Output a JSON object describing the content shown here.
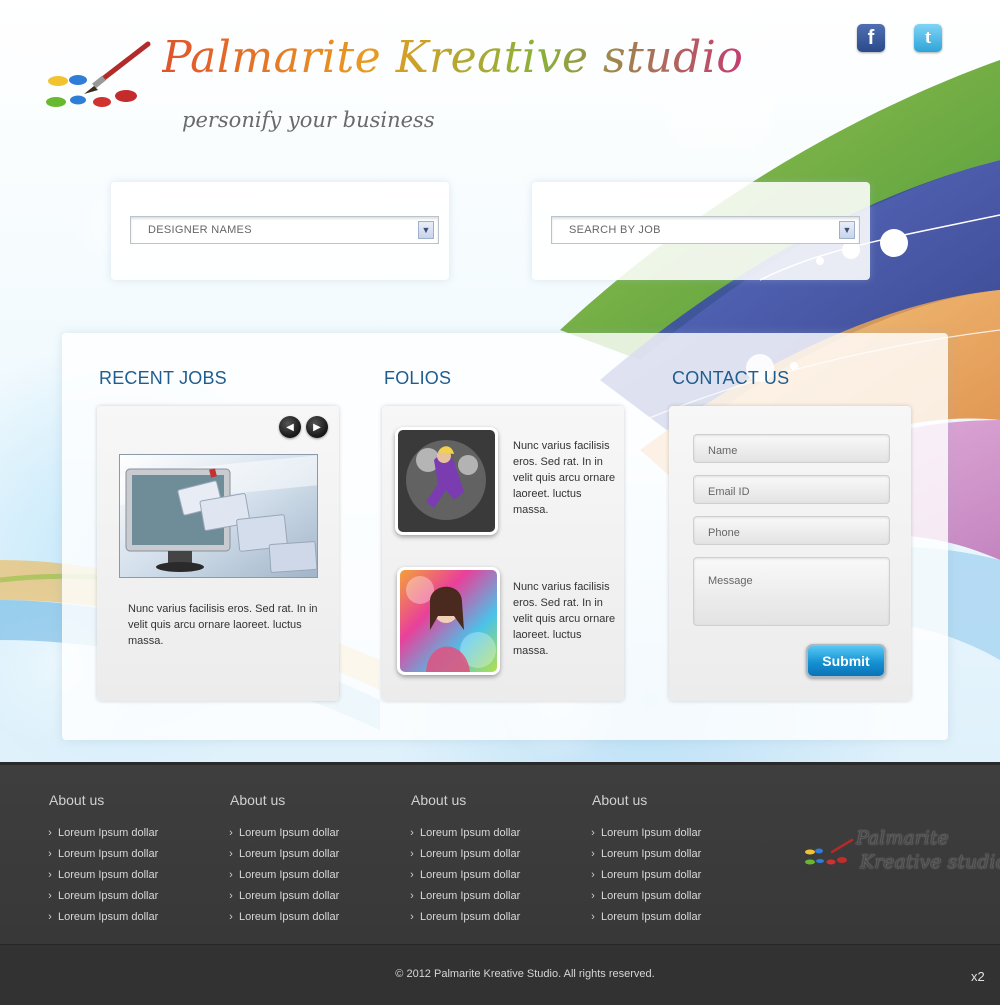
{
  "brand": {
    "title": "Palmarite Kreative studio",
    "tagline": "personify your business"
  },
  "social": {
    "facebook_glyph": "f",
    "twitter_glyph": "t"
  },
  "search": {
    "designer_select": "DESIGNER NAMES",
    "job_select": "SEARCH BY JOB"
  },
  "sections": {
    "recent_jobs": "RECENT JOBS",
    "folios": "FOLIOS",
    "contact_us": "CONTACT US"
  },
  "recent_jobs": {
    "prev_glyph": "◀",
    "next_glyph": "▶",
    "text": "Nunc varius facilisis eros. Sed rat. In in velit quis arcu ornare laoreet. luctus massa."
  },
  "folios": {
    "item1_text": "Nunc varius facilisis eros. Sed rat. In in velit quis arcu ornare laoreet. luctus massa.",
    "item2_text": "Nunc varius facilisis eros. Sed rat. In in velit quis arcu ornare laoreet. luctus massa."
  },
  "contact": {
    "name_placeholder": "Name",
    "email_placeholder": "Email ID",
    "phone_placeholder": "Phone",
    "message_placeholder": "Message",
    "submit_label": "Submit"
  },
  "footer": {
    "columns": [
      {
        "heading": "About us",
        "links": [
          "Loreum Ipsum dollar",
          "Loreum Ipsum dollar",
          "Loreum Ipsum dollar",
          "Loreum Ipsum dollar",
          "Loreum Ipsum dollar"
        ]
      },
      {
        "heading": "About us",
        "links": [
          "Loreum Ipsum dollar",
          "Loreum Ipsum dollar",
          "Loreum Ipsum dollar",
          "Loreum Ipsum dollar",
          "Loreum Ipsum dollar"
        ]
      },
      {
        "heading": "About us",
        "links": [
          "Loreum Ipsum dollar",
          "Loreum Ipsum dollar",
          "Loreum Ipsum dollar",
          "Loreum Ipsum dollar",
          "Loreum Ipsum dollar"
        ]
      },
      {
        "heading": "About us",
        "links": [
          "Loreum Ipsum dollar",
          "Loreum Ipsum dollar",
          "Loreum Ipsum dollar",
          "Loreum Ipsum dollar",
          "Loreum Ipsum dollar"
        ]
      }
    ],
    "logo_line1": "Palmarite",
    "logo_line2": "Kreative studio",
    "copyright": "© 2012 Palmarite Kreative Studio. All rights reserved.",
    "scale_tag": "x2"
  },
  "colors": {
    "accent_blue": "#1f5d8f",
    "submit_blue": "#1591d2",
    "footer_bg": "#3e3e3e"
  }
}
